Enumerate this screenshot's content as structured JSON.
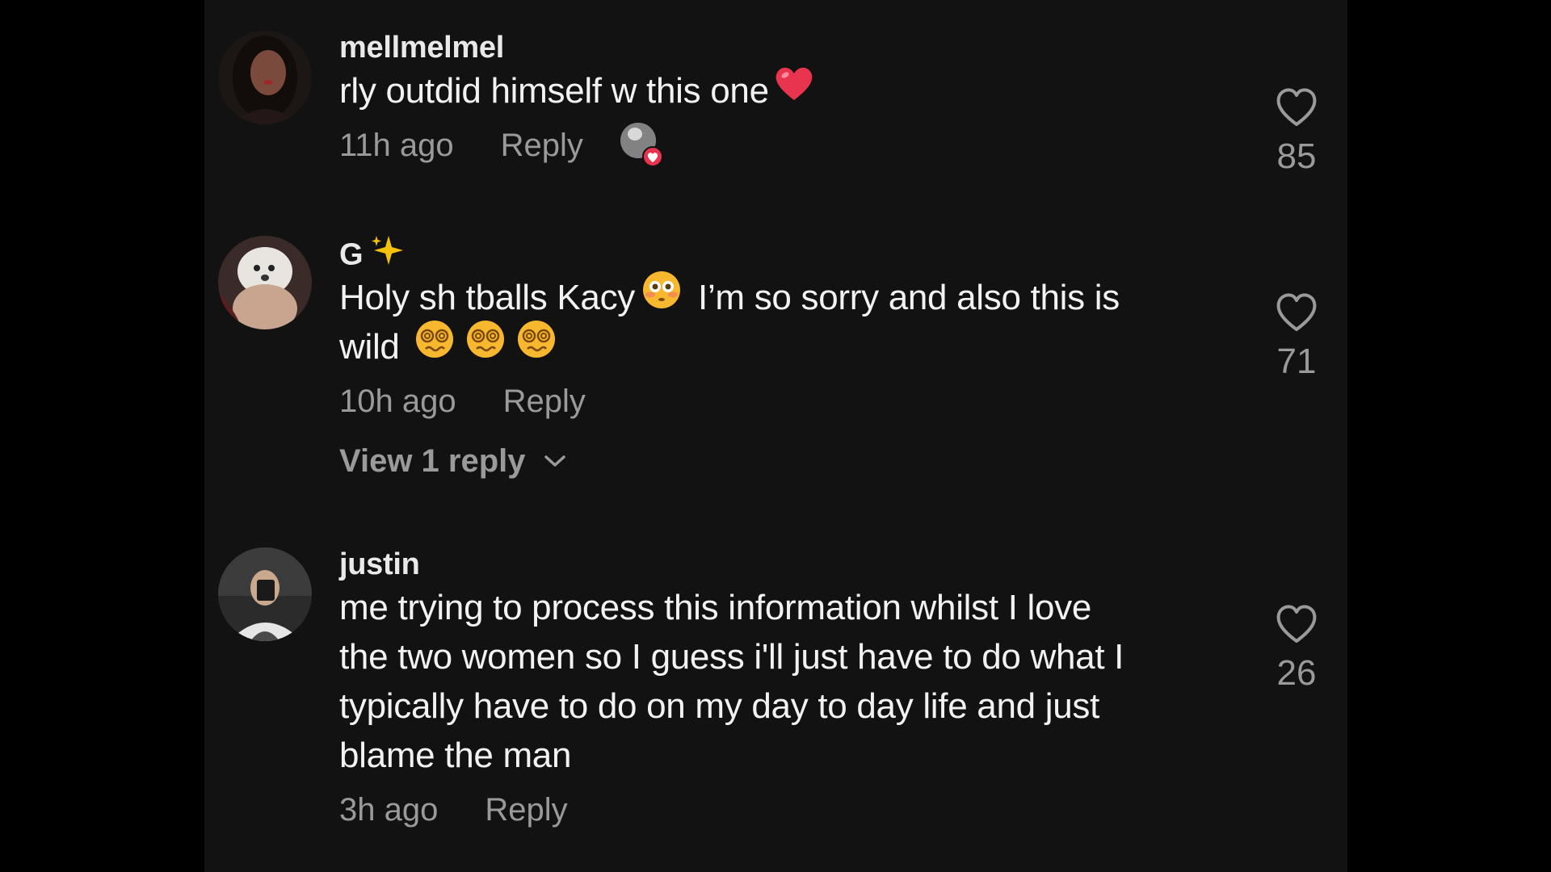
{
  "comments": [
    {
      "username": "mellmelmel",
      "text_lines": [
        "rly outdid himself w this one"
      ],
      "time": "11h ago",
      "reply_label": "Reply",
      "likes": "85",
      "liked_by_creator": true
    },
    {
      "username": "G",
      "text_lines": [
        "Holy sh tballs Kacy",
        "I’m so sorry and also this is",
        "wild"
      ],
      "time": "10h ago",
      "reply_label": "Reply",
      "likes": "71",
      "view_replies": "View 1 reply"
    },
    {
      "username": "justin",
      "text_lines": [
        "me trying to process this information whilst I love",
        "the two women so I guess i'll just have to do what I",
        "typically have to do on my day to day life and just",
        "blame the man"
      ],
      "time": "3h ago",
      "reply_label": "Reply",
      "likes": "26"
    }
  ],
  "colors": {
    "background": "#000000",
    "panel": "#121212",
    "text": "#f2f2f2",
    "muted": "#9a9a9a",
    "heart_red": "#e8344e"
  },
  "icons": [
    "heart-icon",
    "red-heart-emoji",
    "sparkles-emoji",
    "flushed-face-emoji",
    "dizzy-face-emoji",
    "chevron-down-icon"
  ]
}
